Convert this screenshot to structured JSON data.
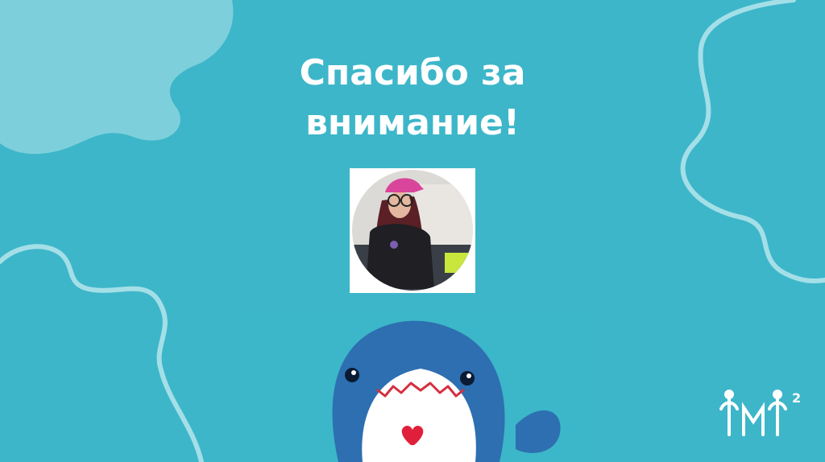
{
  "slide": {
    "title_line1": "Спасибо за",
    "title_line2": "внимание!"
  },
  "colors": {
    "background": "#3db6c9",
    "blob": "#7ecfdc",
    "wave_line": "#a4dfe8",
    "title_text": "#ffffff",
    "shark_body": "#2d6fb0",
    "shark_belly": "#ffffff",
    "heart": "#e0203a"
  },
  "icons": {
    "photo": "portrait-photo",
    "mascot": "blue-shark-illustration",
    "logo": "brand-logo",
    "blob": "blob-decoration",
    "waves": "wave-line-decoration"
  },
  "logo_superscript": "2"
}
